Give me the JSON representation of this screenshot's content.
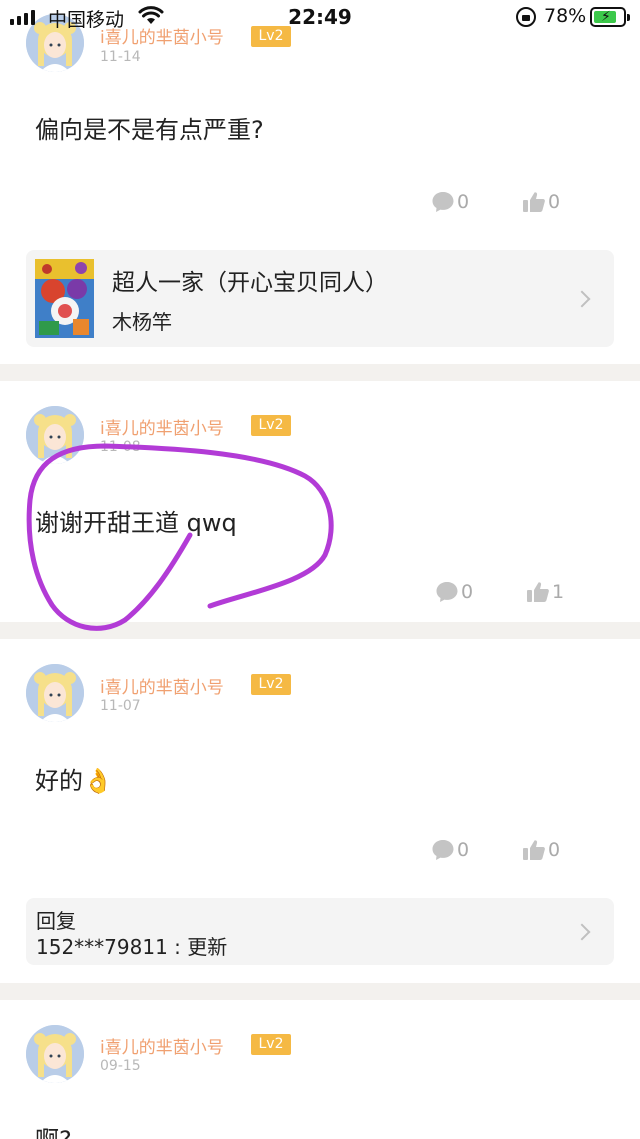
{
  "status_bar": {
    "carrier": "中国移动",
    "time": "22:49",
    "battery": "78%",
    "battery_level": 0.78
  },
  "posts": [
    {
      "author": "i喜儿的芈茵小号",
      "level": "Lv2",
      "date": "11-14",
      "content": "偏向是不是有点严重?",
      "comments": "0",
      "likes": "0",
      "book_card": {
        "title": "超人一家（开心宝贝同人）",
        "author": "木杨竿"
      }
    },
    {
      "author": "i喜儿的芈茵小号",
      "level": "Lv2",
      "date": "11-08",
      "content": "谢谢开甜王道 qwq",
      "comments": "0",
      "likes": "1"
    },
    {
      "author": "i喜儿的芈茵小号",
      "level": "Lv2",
      "date": "11-07",
      "content": "好的👌",
      "comments": "0",
      "likes": "0",
      "reply_card": {
        "label": "回复",
        "text": "152***79811 : 更新"
      }
    },
    {
      "author": "i喜儿的芈茵小号",
      "level": "Lv2",
      "date": "09-15",
      "content": "啊?"
    }
  ],
  "colors": {
    "author": "#f0a070",
    "level_badge": "#f5b944",
    "divider": "#f3f1ee",
    "annotation": "#b23bd6"
  },
  "icons": {
    "comment": "comment-bubble-icon",
    "like": "thumbs-up-icon",
    "chevron": "chevron-right-icon"
  }
}
